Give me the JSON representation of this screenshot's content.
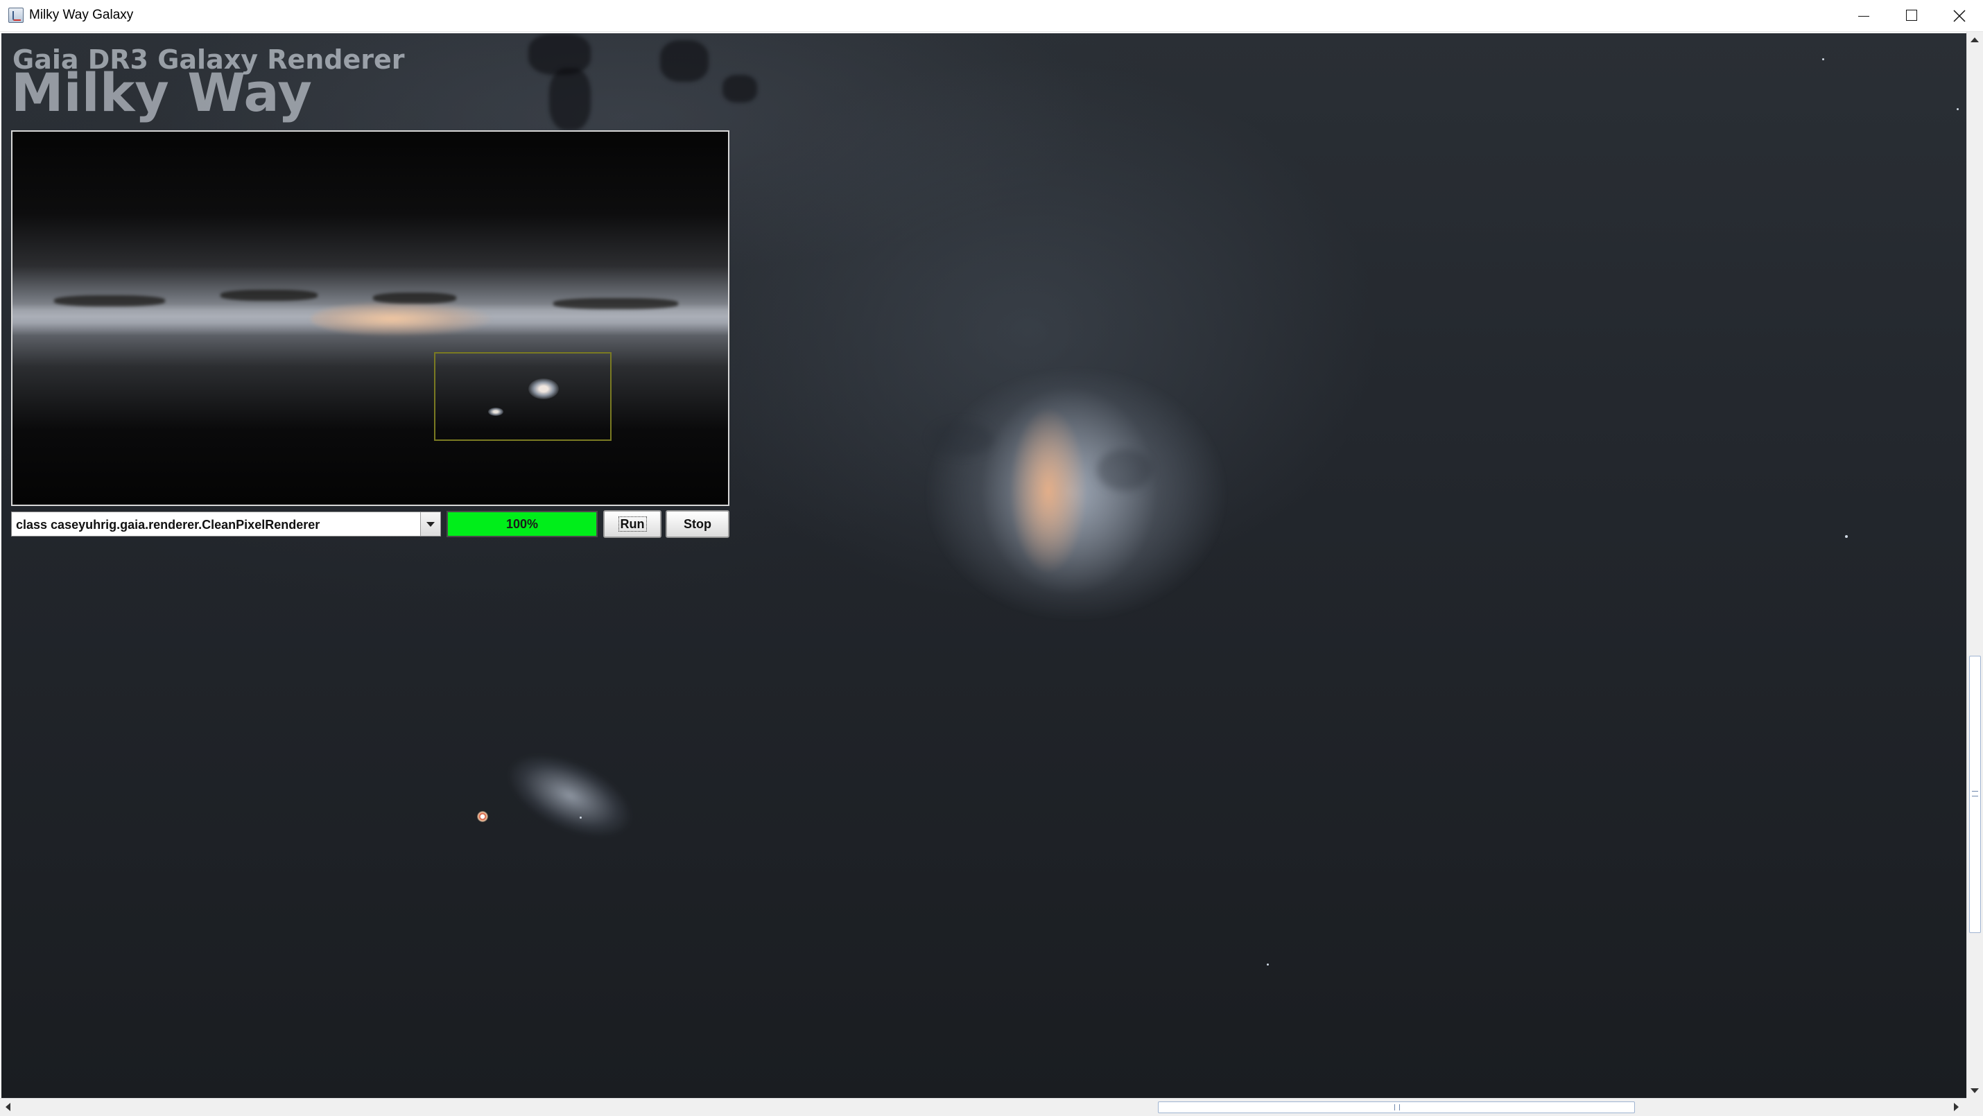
{
  "window": {
    "title": "Milky Way Galaxy",
    "icon": "java-app-icon",
    "controls": [
      "minimize-icon",
      "maximize-icon",
      "close-icon"
    ]
  },
  "overlay": {
    "subtitle": "Gaia DR3 Galaxy Renderer",
    "title": "Milky Way",
    "text_color": "#bec4cc"
  },
  "overview": {
    "view_box_color": "#7a7a22"
  },
  "controls": {
    "renderer_select": {
      "value": "class caseyuhrig.gaia.renderer.CleanPixelRenderer"
    },
    "progress": {
      "value": 1.0,
      "label": "100%",
      "fill_color": "#00ee1a"
    },
    "run_label": "Run",
    "stop_label": "Stop"
  },
  "scrollbars": {
    "vertical": {
      "thumb_position": 0.58
    },
    "horizontal": {
      "thumb_position": 0.59
    }
  }
}
